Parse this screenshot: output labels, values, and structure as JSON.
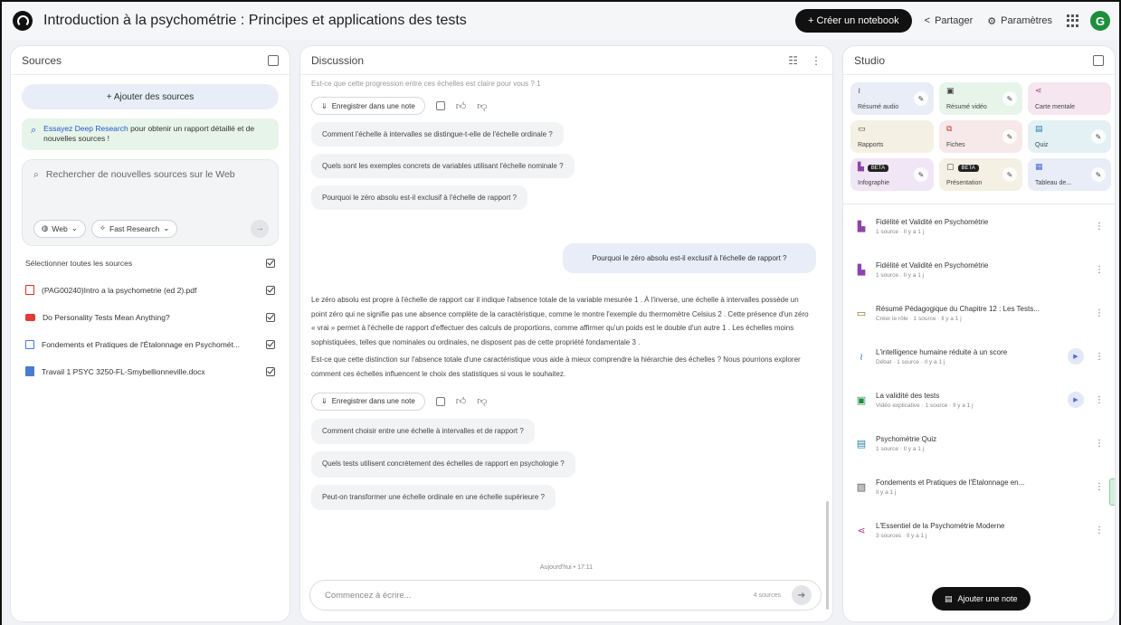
{
  "header": {
    "title": "Introduction à la psychométrie : Principes et applications des tests",
    "create_notebook": "+ Créer un notebook",
    "share": "Partager",
    "settings": "Paramètres",
    "avatar_letter": "G"
  },
  "sources": {
    "title": "Sources",
    "add_sources": "+ Ajouter des sources",
    "promo_highlight": "Essayez Deep Research",
    "promo_text": " pour obtenir un rapport détaillé et de nouvelles sources !",
    "search_placeholder": "Rechercher de nouvelles sources sur le Web",
    "chip_web": "Web",
    "chip_research": "Fast Research",
    "select_all": "Sélectionner toutes les sources",
    "items": [
      {
        "name": "(PAG00240)Intro a la psychometrie (ed 2).pdf",
        "icon": "pdf-icon"
      },
      {
        "name": "Do Personality Tests Mean Anything?",
        "icon": "youtube-icon"
      },
      {
        "name": "Fondements et Pratiques de l'Étalonnage en Psychomét...",
        "icon": "doc-icon"
      },
      {
        "name": "Travail 1 PSYC 3250-FL-Smybellionneville.docx",
        "icon": "docx-icon"
      }
    ]
  },
  "chat": {
    "title": "Discussion",
    "faded_top": "Est-ce que cette progression entre ces échelles est claire pour vous ? 1",
    "save_note": "Enregistrer dans une note",
    "suggestions_1": [
      "Comment l'échelle à intervalles se distingue-t-elle de l'échelle ordinale ?",
      "Quels sont les exemples concrets de variables utilisant l'échelle nominale ?",
      "Pourquoi le zéro absolu est-il exclusif à l'échelle de rapport ?"
    ],
    "user_message": "Pourquoi le zéro absolu est-il exclusif à l'échelle de rapport ?",
    "answer_p1": "Le zéro absolu est propre à l'échelle de rapport car il indique l'absence totale de la variable mesurée 1 . À l'inverse, une échelle à intervalles possède un point zéro qui ne signifie pas une absence complète de la caractéristique, comme le montre l'exemple du thermomètre Celsius 2 . Cette présence d'un zéro « vrai » permet à l'échelle de rapport d'effectuer des calculs de proportions, comme affirmer qu'un poids est le double d'un autre 1 . Les échelles moins sophistiquées, telles que nominales ou ordinales, ne disposent pas de cette propriété fondamentale 3 .",
    "answer_p2": "Est-ce que cette distinction sur l'absence totale d'une caractéristique vous aide à mieux comprendre la hiérarchie des échelles ? Nous pourrions explorer comment ces échelles influencent le choix des statistiques si vous le souhaitez.",
    "suggestions_2": [
      "Comment choisir entre une échelle à intervalles et de rapport ?",
      "Quels tests utilisent concrètement des échelles de rapport en psychologie ?",
      "Peut-on transformer une échelle ordinale en une échelle supérieure ?"
    ],
    "timestamp": "Aujourd'hui • 17:11",
    "composer_placeholder": "Commencez à écrire...",
    "source_count": "4 sources"
  },
  "studio": {
    "title": "Studio",
    "tiles": [
      {
        "label": "Résumé audio",
        "icon": "audio-icon",
        "color": "#e8edf7"
      },
      {
        "label": "Résumé vidéo",
        "icon": "video-icon",
        "color": "#e7f4ea"
      },
      {
        "label": "Carte mentale",
        "icon": "mindmap-icon",
        "color": "#f5e6f0"
      },
      {
        "label": "Rapports",
        "icon": "report-icon",
        "color": "#f4f0e3"
      },
      {
        "label": "Fiches",
        "icon": "flashcard-icon",
        "color": "#f7e9e9"
      },
      {
        "label": "Quiz",
        "icon": "quiz-icon",
        "color": "#e3f1f5"
      },
      {
        "label": "Infographie",
        "icon": "infographic-icon",
        "color": "#f1e6f5",
        "badge": "BETA"
      },
      {
        "label": "Présentation",
        "icon": "presentation-icon",
        "color": "#f4f0e3",
        "badge": "BETA"
      },
      {
        "label": "Tableau de...",
        "icon": "table-icon",
        "color": "#e8edf7"
      }
    ],
    "items": [
      {
        "title": "Fidélité et Validité en Psychométrie",
        "sub": "1 source · Il y a 1 j",
        "icon": "infographic-icon",
        "play": false
      },
      {
        "title": "Fidélité et Validité en Psychométrie",
        "sub": "1 source · Il y a 1 j",
        "icon": "infographic-icon",
        "play": false
      },
      {
        "title": "Résumé Pédagogique du Chapitre 12 : Les Tests...",
        "sub": "Créer le rôle · 1 source · Il y a 1 j",
        "icon": "report-icon",
        "play": false
      },
      {
        "title": "L'intelligence humaine réduite à un score",
        "sub": "Débat · 1 source · Il y a 1 j",
        "icon": "audio-icon",
        "play": true
      },
      {
        "title": "La validité des tests",
        "sub": "Vidéo explicative · 1 source · Il y a 1 j",
        "icon": "video-icon",
        "play": true
      },
      {
        "title": "Psychométrie Quiz",
        "sub": "1 source · Il y a 1 j",
        "icon": "quiz-icon",
        "play": false
      },
      {
        "title": "Fondements et Pratiques de l'Étalonnage en...",
        "sub": "Il y a 1 j",
        "icon": "note-icon",
        "play": false
      },
      {
        "title": "L'Essentiel de la Psychométrie Moderne",
        "sub": "3 sources · Il y a 1 j",
        "icon": "mindmap-icon",
        "play": false
      }
    ],
    "add_note": "Ajouter une note"
  }
}
